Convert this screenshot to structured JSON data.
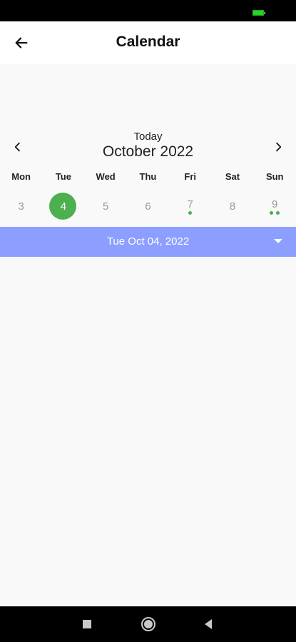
{
  "app_bar": {
    "title": "Calendar"
  },
  "calendar": {
    "today_label": "Today",
    "month_label": "October 2022",
    "weekdays": [
      "Mon",
      "Tue",
      "Wed",
      "Thu",
      "Fri",
      "Sat",
      "Sun"
    ],
    "days": [
      {
        "num": "3",
        "selected": false,
        "dots": 0
      },
      {
        "num": "4",
        "selected": true,
        "dots": 0
      },
      {
        "num": "5",
        "selected": false,
        "dots": 0
      },
      {
        "num": "6",
        "selected": false,
        "dots": 0
      },
      {
        "num": "7",
        "selected": false,
        "dots": 1
      },
      {
        "num": "8",
        "selected": false,
        "dots": 0
      },
      {
        "num": "9",
        "selected": false,
        "dots": 2
      }
    ],
    "selected_date_label": "Tue Oct 04, 2022"
  },
  "colors": {
    "accent_green": "#4caf50",
    "date_bar": "#8c9eff",
    "battery": "#2bd12b"
  },
  "icons": {
    "back": "arrow-left-icon",
    "prev": "chevron-left-icon",
    "next": "chevron-right-icon",
    "dropdown": "caret-down-icon"
  }
}
